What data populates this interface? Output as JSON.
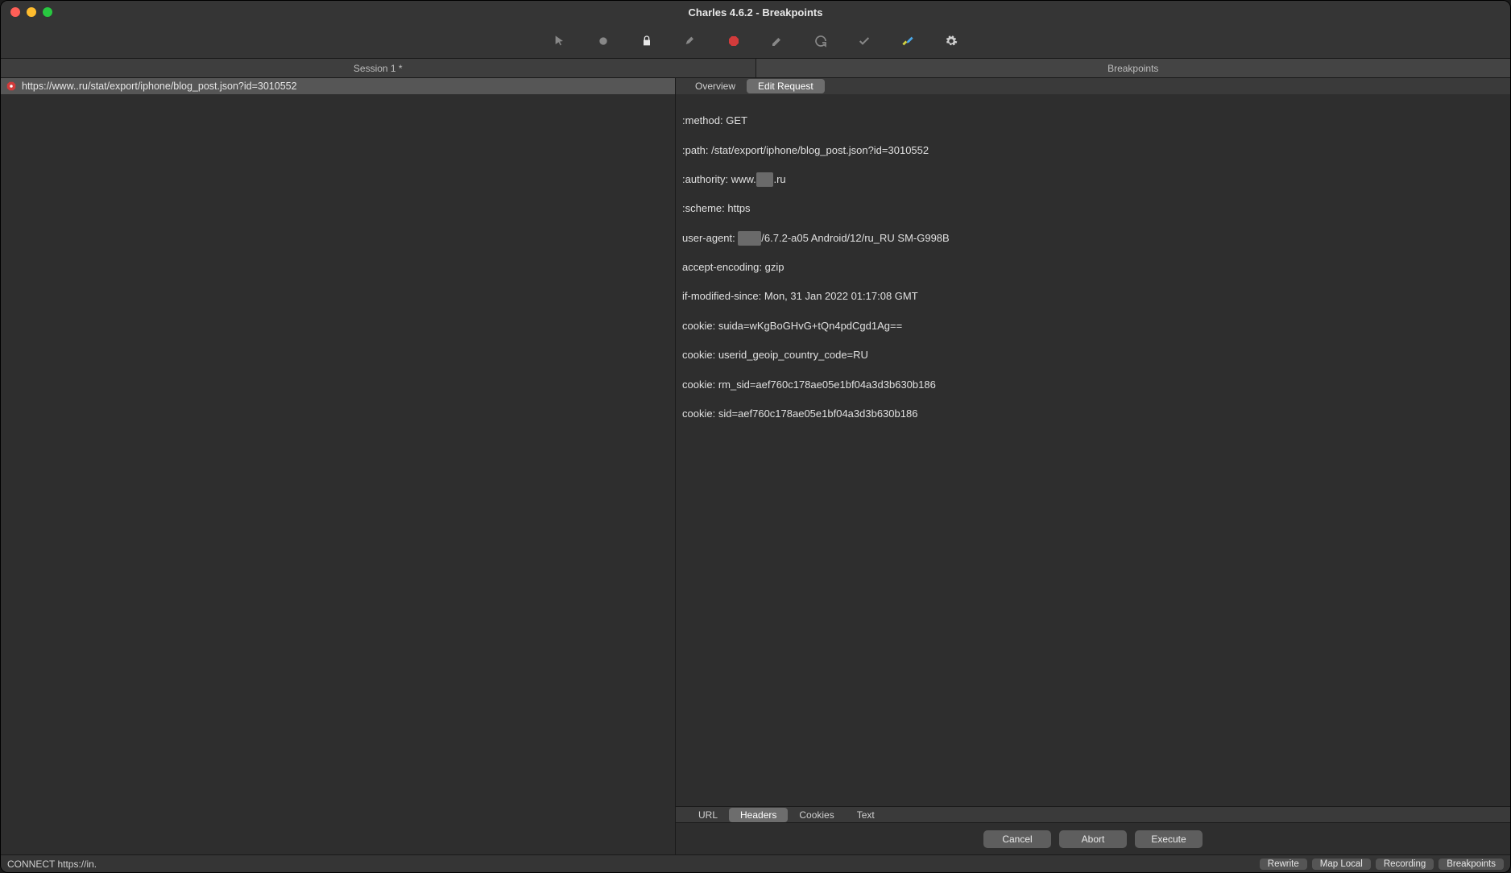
{
  "window": {
    "title": "Charles 4.6.2 - Breakpoints"
  },
  "toolbar_icons": {
    "pointer": "pointer-icon",
    "record": "record-icon",
    "lock": "lock-icon",
    "broom": "broom-icon",
    "stop": "stop-icon",
    "pencil": "pencil-icon",
    "refresh": "refresh-icon",
    "check": "check-icon",
    "tools": "tools-icon",
    "gear": "gear-icon"
  },
  "main_tabs": {
    "left": "Session 1 *",
    "right": "Breakpoints"
  },
  "request_list": {
    "items": [
      {
        "url_prefix": "https://www.",
        "url_redacted": "     ",
        "url_suffix": ".ru/stat/export/iphone/blog_post.json?id=3010552"
      }
    ]
  },
  "subtabs": {
    "overview": "Overview",
    "edit_request": "Edit Request"
  },
  "headers": {
    "method": {
      "k": ":method:",
      "v": "GET"
    },
    "path": {
      "k": ":path:",
      "v": "/stat/export/iphone/blog_post.json?id=3010552"
    },
    "authority": {
      "k": ":authority:",
      "pre": "www.",
      "red": "      ",
      "suf": ".ru"
    },
    "scheme": {
      "k": ":scheme:",
      "v": "https"
    },
    "ua": {
      "k": "user-agent:",
      "red": "        ",
      "suf": "/6.7.2-a05 Android/12/ru_RU SM-G998B"
    },
    "ae": {
      "k": "accept-encoding:",
      "v": "gzip"
    },
    "ims": {
      "k": "if-modified-since:",
      "v": "Mon, 31 Jan 2022 01:17:08 GMT"
    },
    "c1": {
      "k": "cookie:",
      "v": "suida=wKgBoGHvG+tQn4pdCgd1Ag=="
    },
    "c2": {
      "k": "cookie:",
      "v": "userid_geoip_country_code=RU"
    },
    "c3": {
      "k": "cookie:",
      "v": "rm_sid=aef760c178ae05e1bf04a3d3b630b186"
    },
    "c4": {
      "k": "cookie:",
      "v": "sid=aef760c178ae05e1bf04a3d3b630b186"
    }
  },
  "bottom_tabs": {
    "url": "URL",
    "headers": "Headers",
    "cookies": "Cookies",
    "text": "Text"
  },
  "actions": {
    "cancel": "Cancel",
    "abort": "Abort",
    "execute": "Execute"
  },
  "status": {
    "left_pre": "CONNECT https://in.",
    "left_red": "        ",
    "right": {
      "rewrite": "Rewrite",
      "map_local": "Map Local",
      "recording": "Recording",
      "breakpoints": "Breakpoints"
    }
  }
}
